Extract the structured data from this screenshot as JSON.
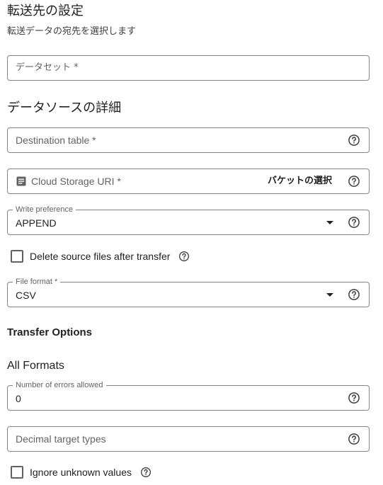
{
  "destination": {
    "title": "転送先の設定",
    "subtitle": "転送データの宛先を選択します",
    "dataset_placeholder": "データセット *"
  },
  "source": {
    "title": "データソースの詳細",
    "destination_table_placeholder": "Destination table *",
    "cloud_storage_uri_placeholder": "Cloud Storage URI *",
    "browse_label": "バケットの選択",
    "write_preference": {
      "label": "Write preference",
      "value": "APPEND"
    },
    "delete_source_label": "Delete source files after transfer",
    "file_format": {
      "label": "File format *",
      "value": "CSV"
    }
  },
  "transfer_options": {
    "title": "Transfer Options",
    "all_formats_title": "All Formats",
    "errors_allowed": {
      "label": "Number of errors allowed",
      "value": "0"
    },
    "decimal_target_types_placeholder": "Decimal target types",
    "ignore_unknown_label": "Ignore unknown values"
  },
  "icons": {
    "help": "help-circle-icon",
    "document": "document-icon",
    "dropdown": "caret-down-icon"
  },
  "colors": {
    "border": "#80868b",
    "text": "#202124",
    "muted": "#5f6368"
  }
}
